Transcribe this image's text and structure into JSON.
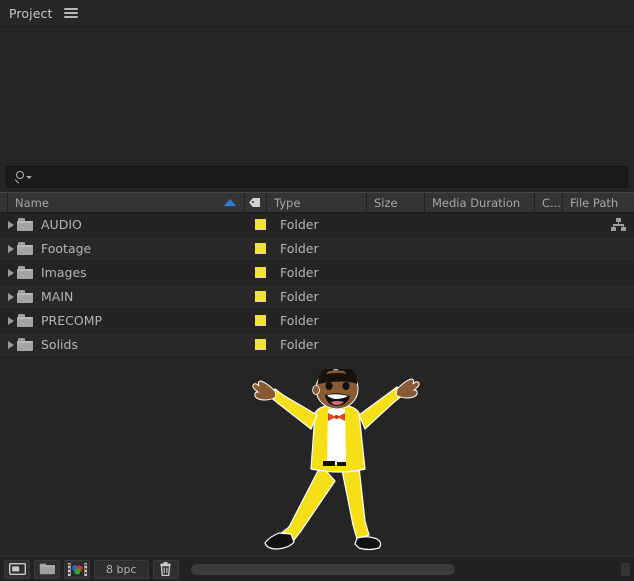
{
  "panel": {
    "tab_title": "Project",
    "menu_icon": "hamburger-menu-icon"
  },
  "search": {
    "value": "",
    "placeholder": "",
    "icon": "search-icon",
    "dropdown_icon": "chevron-down-icon"
  },
  "columns": [
    {
      "key": "name",
      "label": "Name",
      "sort": "ascending"
    },
    {
      "key": "label",
      "label": "",
      "icon": "tag-icon"
    },
    {
      "key": "type",
      "label": "Type"
    },
    {
      "key": "size",
      "label": "Size"
    },
    {
      "key": "duration",
      "label": "Media Duration"
    },
    {
      "key": "comment",
      "label": "C..."
    },
    {
      "key": "filepath",
      "label": "File Path"
    }
  ],
  "items": [
    {
      "name": "AUDIO",
      "type": "Folder",
      "size": "",
      "duration": "",
      "comment": "",
      "filepath": "",
      "label_color": "#efe04a",
      "expanded": false,
      "has_hierarchy_icon": true
    },
    {
      "name": "Footage",
      "type": "Folder",
      "size": "",
      "duration": "",
      "comment": "",
      "filepath": "",
      "label_color": "#efe04a",
      "expanded": false,
      "has_hierarchy_icon": false
    },
    {
      "name": "Images",
      "type": "Folder",
      "size": "",
      "duration": "",
      "comment": "",
      "filepath": "",
      "label_color": "#efe04a",
      "expanded": false,
      "has_hierarchy_icon": false
    },
    {
      "name": "MAIN",
      "type": "Folder",
      "size": "",
      "duration": "",
      "comment": "",
      "filepath": "",
      "label_color": "#efe04a",
      "expanded": false,
      "has_hierarchy_icon": false
    },
    {
      "name": "PRECOMP",
      "type": "Folder",
      "size": "",
      "duration": "",
      "comment": "",
      "filepath": "",
      "label_color": "#efe04a",
      "expanded": false,
      "has_hierarchy_icon": false
    },
    {
      "name": "Solids",
      "type": "Folder",
      "size": "",
      "duration": "",
      "comment": "",
      "filepath": "",
      "label_color": "#efe04a",
      "expanded": false,
      "has_hierarchy_icon": false
    }
  ],
  "toolbar": {
    "new_composition_icon": "new-composition-icon",
    "new_folder_icon": "new-folder-icon",
    "project_settings_icon": "color-depth-icon",
    "bit_depth_label": "8 bpc",
    "delete_icon": "trash-icon"
  },
  "illustration": {
    "name": "dancing-character",
    "suit_color": "#f5e017",
    "shirt_color": "#ffffff",
    "bowtie_color": "#d94726",
    "skin_color": "#8a5a33",
    "hair_color": "#16110d",
    "shoe_color": "#111111"
  },
  "colors": {
    "panel_background": "#252525",
    "header_background": "#343434",
    "sort_indicator": "#2f7fd6",
    "label_swatch": "#efe04a",
    "text_primary": "#b4b4b4"
  }
}
